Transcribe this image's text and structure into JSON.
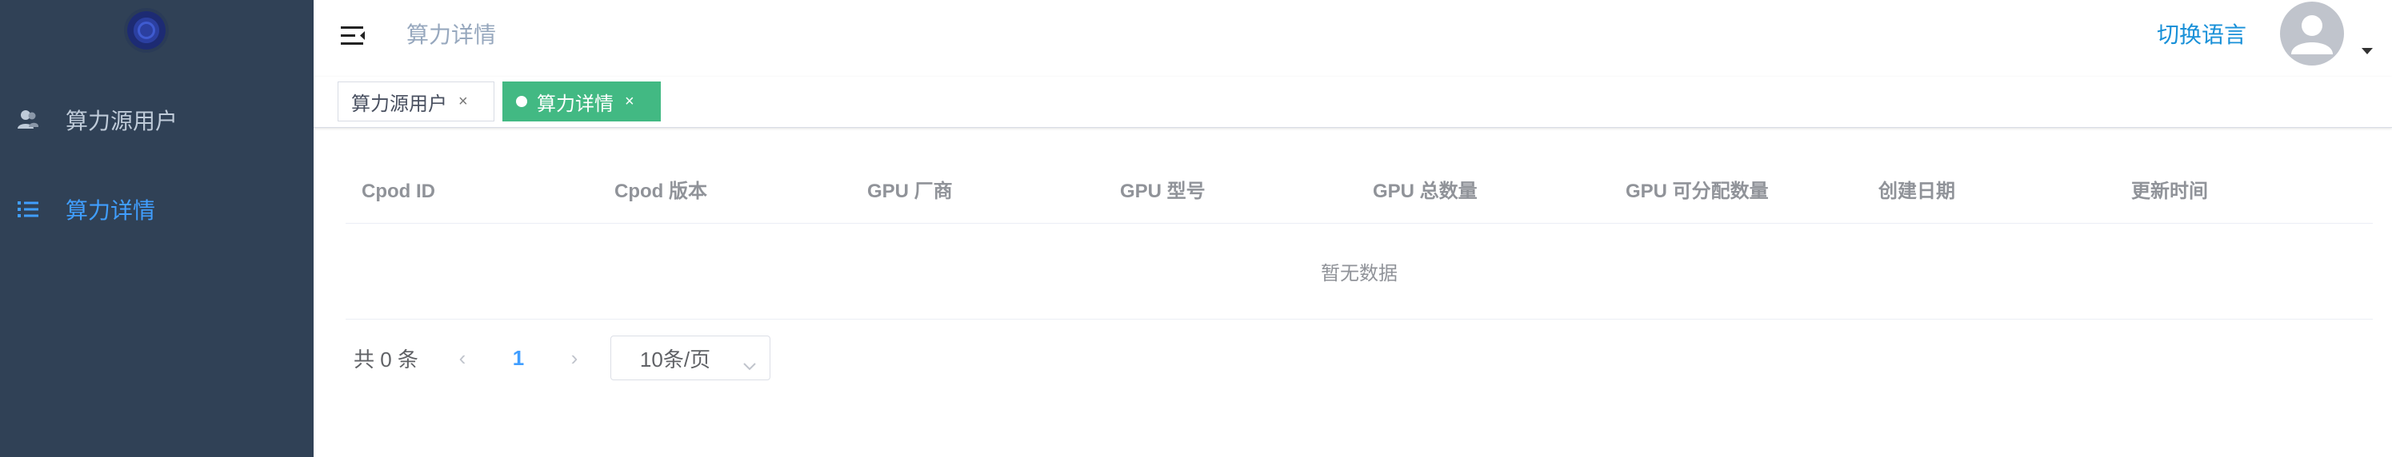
{
  "sidebar": {
    "items": [
      {
        "label": "算力源用户",
        "icon": "users-icon",
        "active": false
      },
      {
        "label": "算力详情",
        "icon": "list-icon",
        "active": true
      }
    ]
  },
  "header": {
    "breadcrumb": "算力详情",
    "lang_switch": "切换语言"
  },
  "tags": [
    {
      "label": "算力源用户",
      "close": "×",
      "active": false
    },
    {
      "label": "算力详情",
      "close": "×",
      "active": true
    }
  ],
  "table": {
    "columns": [
      "Cpod ID",
      "Cpod 版本",
      "GPU 厂商",
      "GPU 型号",
      "GPU 总数量",
      "GPU 可分配数量",
      "创建日期",
      "更新时间"
    ],
    "empty_text": "暂无数据"
  },
  "pagination": {
    "total": "共 0 条",
    "prev": "‹",
    "next": "›",
    "current_page": "1",
    "page_size": "10条/页"
  },
  "colors": {
    "sidebar_bg": "#304156",
    "menu_active": "#409eff",
    "tag_active": "#42b983",
    "lang_link": "#1890d8"
  }
}
